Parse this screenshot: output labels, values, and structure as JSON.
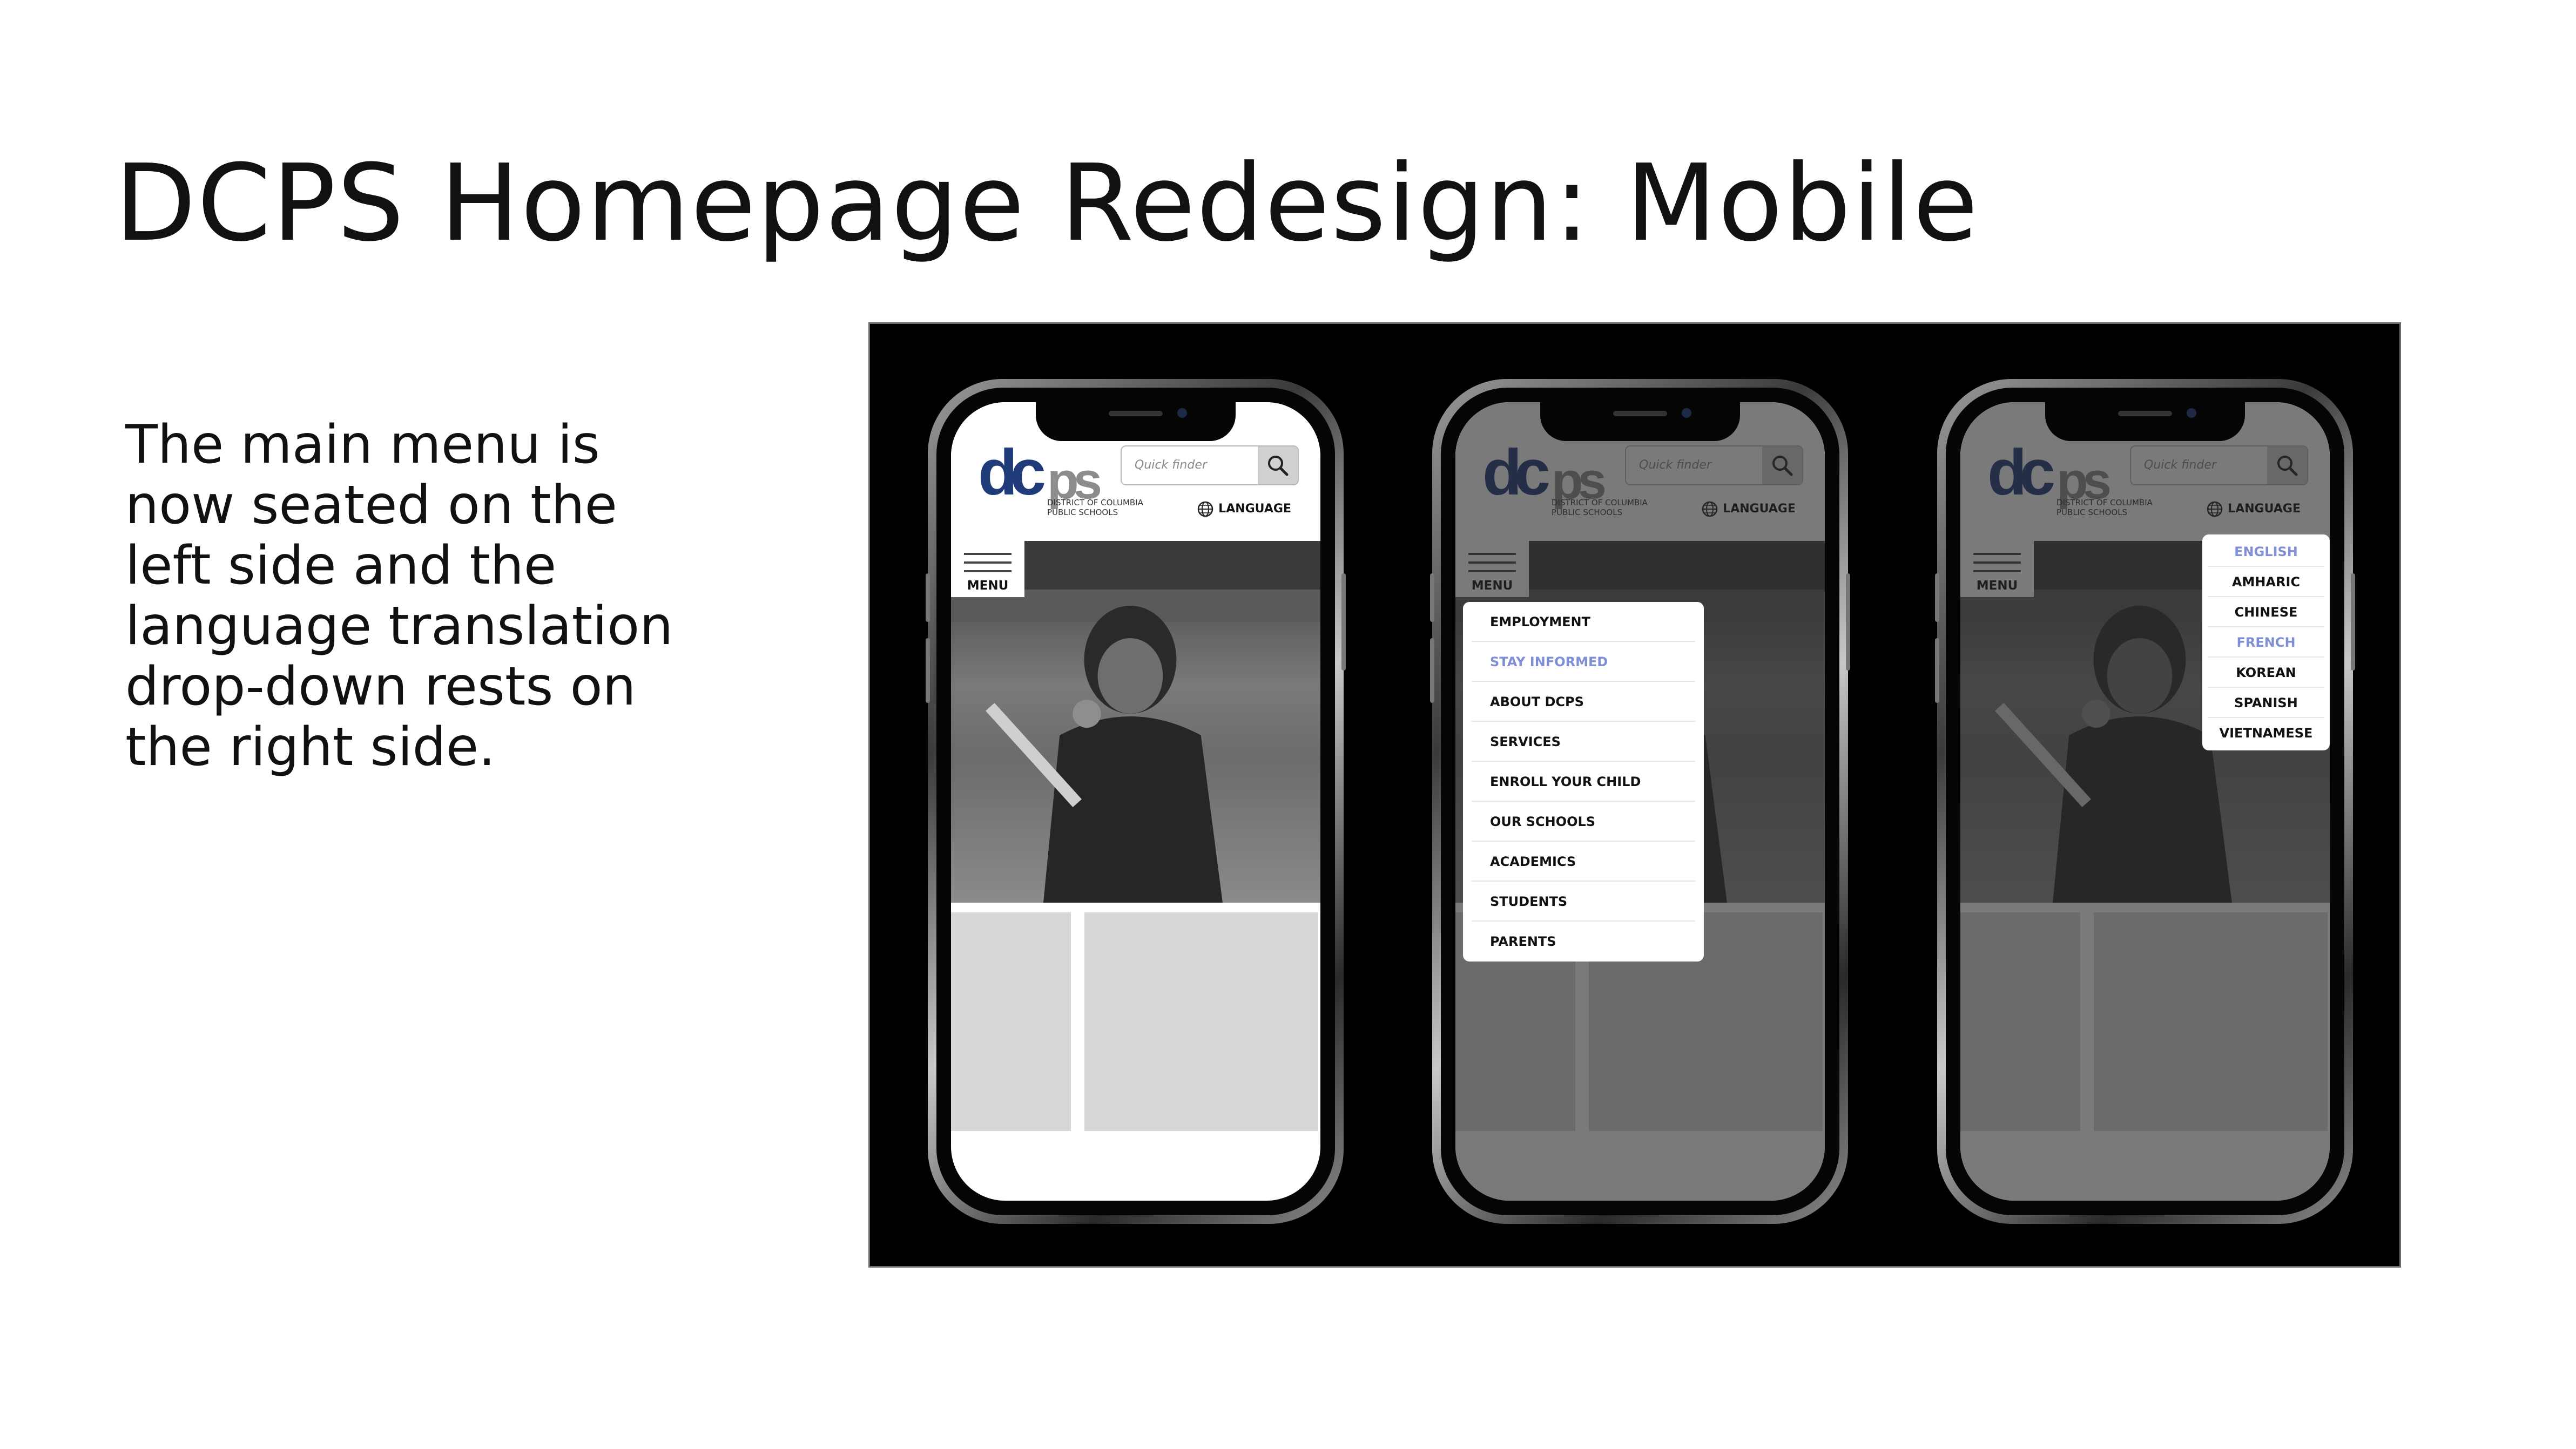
{
  "slide": {
    "title": "DCPS Homepage Redesign: Mobile",
    "description": "The main menu is now seated on the left side and the language translation drop-down rests on the right side."
  },
  "site": {
    "logo_sub_line1": "DISTRICT OF COLUMBIA",
    "logo_sub_line2": "PUBLIC SCHOOLS",
    "search_placeholder": "Quick finder",
    "language_label": "LANGUAGE",
    "menu_label": "MENU",
    "logo_text_dc": "dc",
    "logo_text_ps": "ps"
  },
  "main_menu": {
    "items": [
      "EMPLOYMENT",
      "STAY INFORMED",
      "ABOUT DCPS",
      "SERVICES",
      "ENROLL YOUR CHILD",
      "OUR SCHOOLS",
      "ACADEMICS",
      "STUDENTS",
      "PARENTS"
    ],
    "highlighted_item": "STAY INFORMED"
  },
  "language_menu": {
    "items": [
      "ENGLISH",
      "AMHARIC",
      "CHINESE",
      "FRENCH",
      "KOREAN",
      "SPANISH",
      "VIETNAMESE"
    ],
    "highlighted_items": [
      "ENGLISH",
      "FRENCH"
    ]
  },
  "colors": {
    "highlight": "#7f8fd6",
    "logo_dc": "#1f3b7a",
    "logo_ps": "#8c8c8c",
    "panel_bg": "#000000"
  },
  "phones": [
    {
      "state": "default"
    },
    {
      "state": "main-menu-open"
    },
    {
      "state": "language-menu-open"
    }
  ]
}
